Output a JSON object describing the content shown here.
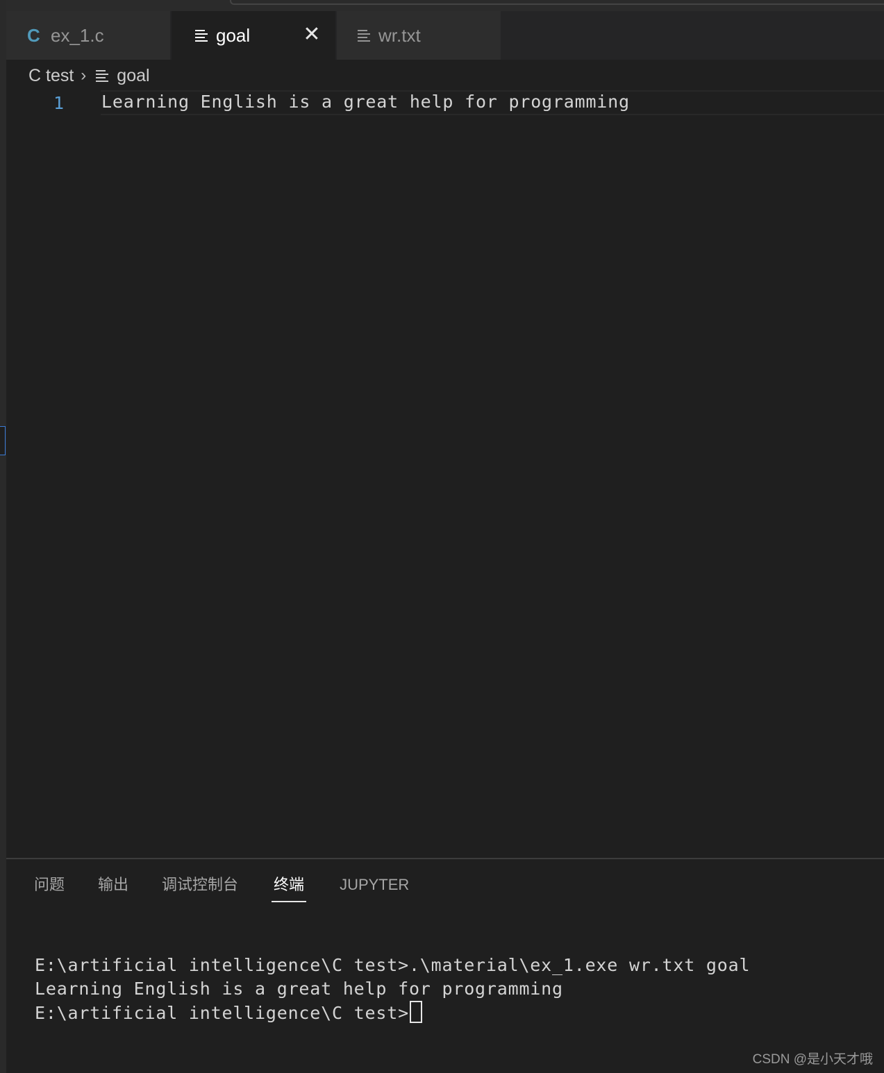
{
  "tabs": [
    {
      "label": "ex_1.c",
      "icon": "c-file-icon",
      "active": false
    },
    {
      "label": "goal",
      "icon": "text-file-icon",
      "active": true
    },
    {
      "label": "wr.txt",
      "icon": "text-file-icon",
      "active": false
    }
  ],
  "c_icon_glyph": "C",
  "close_glyph": "✕",
  "breadcrumb": {
    "folder": "C test",
    "separator": "›",
    "file": "goal"
  },
  "editor": {
    "line_number": "1",
    "line_text": "Learning English is a great help for programming"
  },
  "panel": {
    "tabs": [
      "问题",
      "输出",
      "调试控制台",
      "终端",
      "JUPYTER"
    ],
    "active_tab": "终端"
  },
  "terminal": {
    "line1": "E:\\artificial intelligence\\C test>.\\material\\ex_1.exe wr.txt goal",
    "line2": "Learning English is a great help for programming",
    "prompt": "E:\\artificial intelligence\\C test>"
  },
  "watermark": "CSDN @是小天才哦",
  "colors": {
    "background": "#1f1f1f",
    "c_icon": "#519aba",
    "line_number": "#5a9fd6"
  }
}
